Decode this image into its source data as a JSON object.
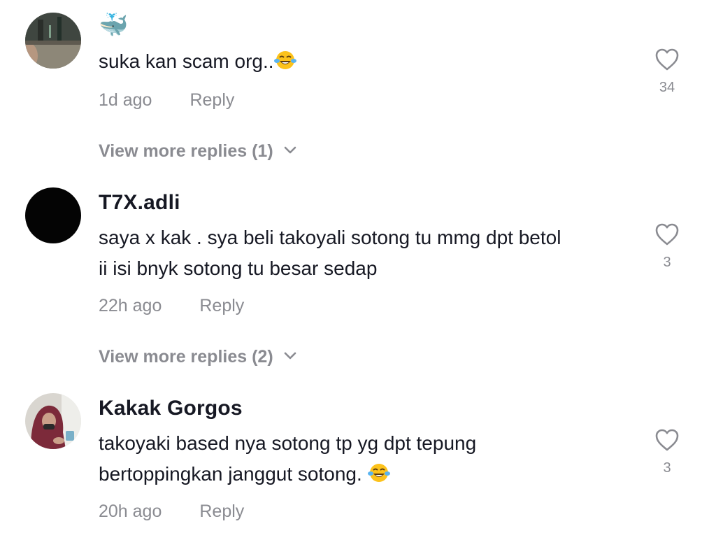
{
  "comments": [
    {
      "username": "🐳",
      "text": "suka kan scam org..",
      "text_emoji": "😂",
      "time": "1d ago",
      "reply_label": "Reply",
      "likes": "34",
      "view_more": "View more replies (1)"
    },
    {
      "username": "T7X.adli",
      "text_line1": "saya x kak . sya beli takoyali sotong tu mmg dpt betol",
      "text_line2": "ii isi bnyk sotong tu besar sedap",
      "time": "22h ago",
      "reply_label": "Reply",
      "likes": "3",
      "view_more": "View more replies (2)"
    },
    {
      "username": "Kakak Gorgos",
      "text_line1": "takoyaki based nya sotong tp yg dpt tepung",
      "text_line2": "bertoppingkan janggut sotong.",
      "text_emoji": "😂",
      "time": "20h ago",
      "reply_label": "Reply",
      "likes": "3"
    }
  ],
  "icons": {
    "like": "heart-outline-icon",
    "expand": "chevron-down-icon",
    "laugh": "tears-of-joy-emoji"
  },
  "colors": {
    "text_primary": "#161823",
    "text_secondary": "#8a8b91",
    "background": "#ffffff"
  }
}
